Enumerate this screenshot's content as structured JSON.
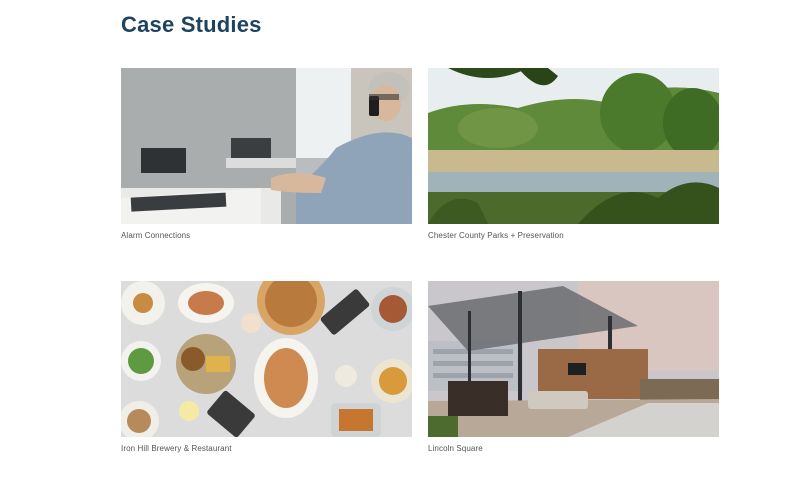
{
  "page": {
    "title": "Case Studies"
  },
  "case_studies": [
    {
      "caption": "Alarm Connections",
      "image": "office-man-on-phone"
    },
    {
      "caption": "Chester County Parks + Preservation",
      "image": "marsh-landscape"
    },
    {
      "caption": "Iron Hill Brewery & Restaurant",
      "image": "food-spread-overhead"
    },
    {
      "caption": "Lincoln Square",
      "image": "rooftop-terrace-dusk"
    }
  ]
}
